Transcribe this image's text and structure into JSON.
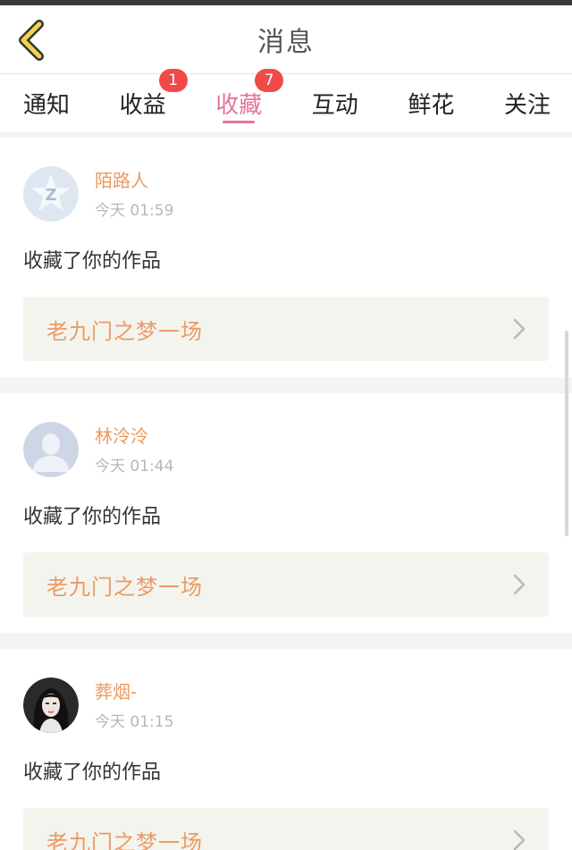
{
  "header": {
    "title": "消息"
  },
  "tabs": [
    {
      "label": "通知"
    },
    {
      "label": "收益",
      "badge": "1"
    },
    {
      "label": "收藏",
      "badge": "7",
      "active": true
    },
    {
      "label": "互动"
    },
    {
      "label": "鲜花"
    },
    {
      "label": "关注"
    }
  ],
  "items": [
    {
      "name": "陌路人",
      "time": "今天 01:59",
      "action": "收藏了你的作品",
      "work": "老九门之梦一场",
      "avatar": "qq-default-avatar"
    },
    {
      "name": "林泠泠",
      "time": "今天 01:44",
      "action": "收藏了你的作品",
      "work": "老九门之梦一场",
      "avatar": "silhouette-avatar"
    },
    {
      "name": "葬烟-",
      "time": "今天 01:15",
      "action": "收藏了你的作品",
      "work": "老九门之梦一场",
      "avatar": "photo-avatar"
    }
  ],
  "colors": {
    "accent": "#e5739e",
    "name": "#ec9a5e",
    "badge": "#f04a48",
    "back": "#f2d34a"
  }
}
